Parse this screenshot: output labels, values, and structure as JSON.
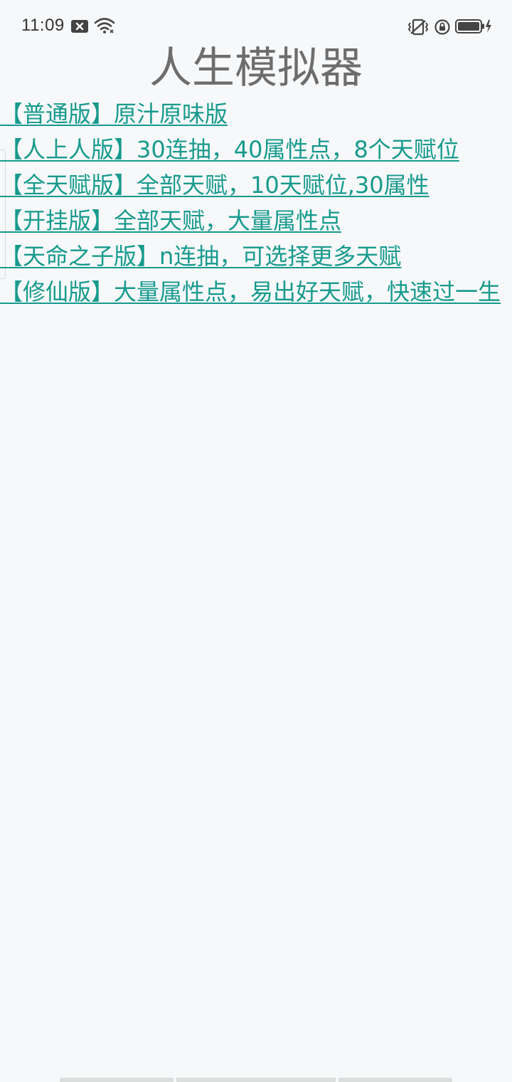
{
  "status_bar": {
    "time": "11:09",
    "left_icons": [
      "notification-close-icon",
      "wifi-icon"
    ],
    "right_icons": [
      "vibrate-icon",
      "orientation-lock-icon",
      "battery-charging-icon"
    ]
  },
  "app": {
    "title": "人生模拟器"
  },
  "versions": [
    {
      "label": "【普通版】原汁原味版"
    },
    {
      "label": "【人上人版】30连抽，40属性点，8个天赋位"
    },
    {
      "label": "【全天赋版】全部天赋，10天赋位,30属性"
    },
    {
      "label": "【开挂版】全部天赋，大量属性点"
    },
    {
      "label": "【天命之子版】n连抽，可选择更多天赋"
    },
    {
      "label": "【修仙版】大量属性点，易出好天赋，快速过一生"
    }
  ],
  "colors": {
    "link": "#169a8d",
    "title": "#6d6d6d",
    "background": "#f7f8f9"
  }
}
